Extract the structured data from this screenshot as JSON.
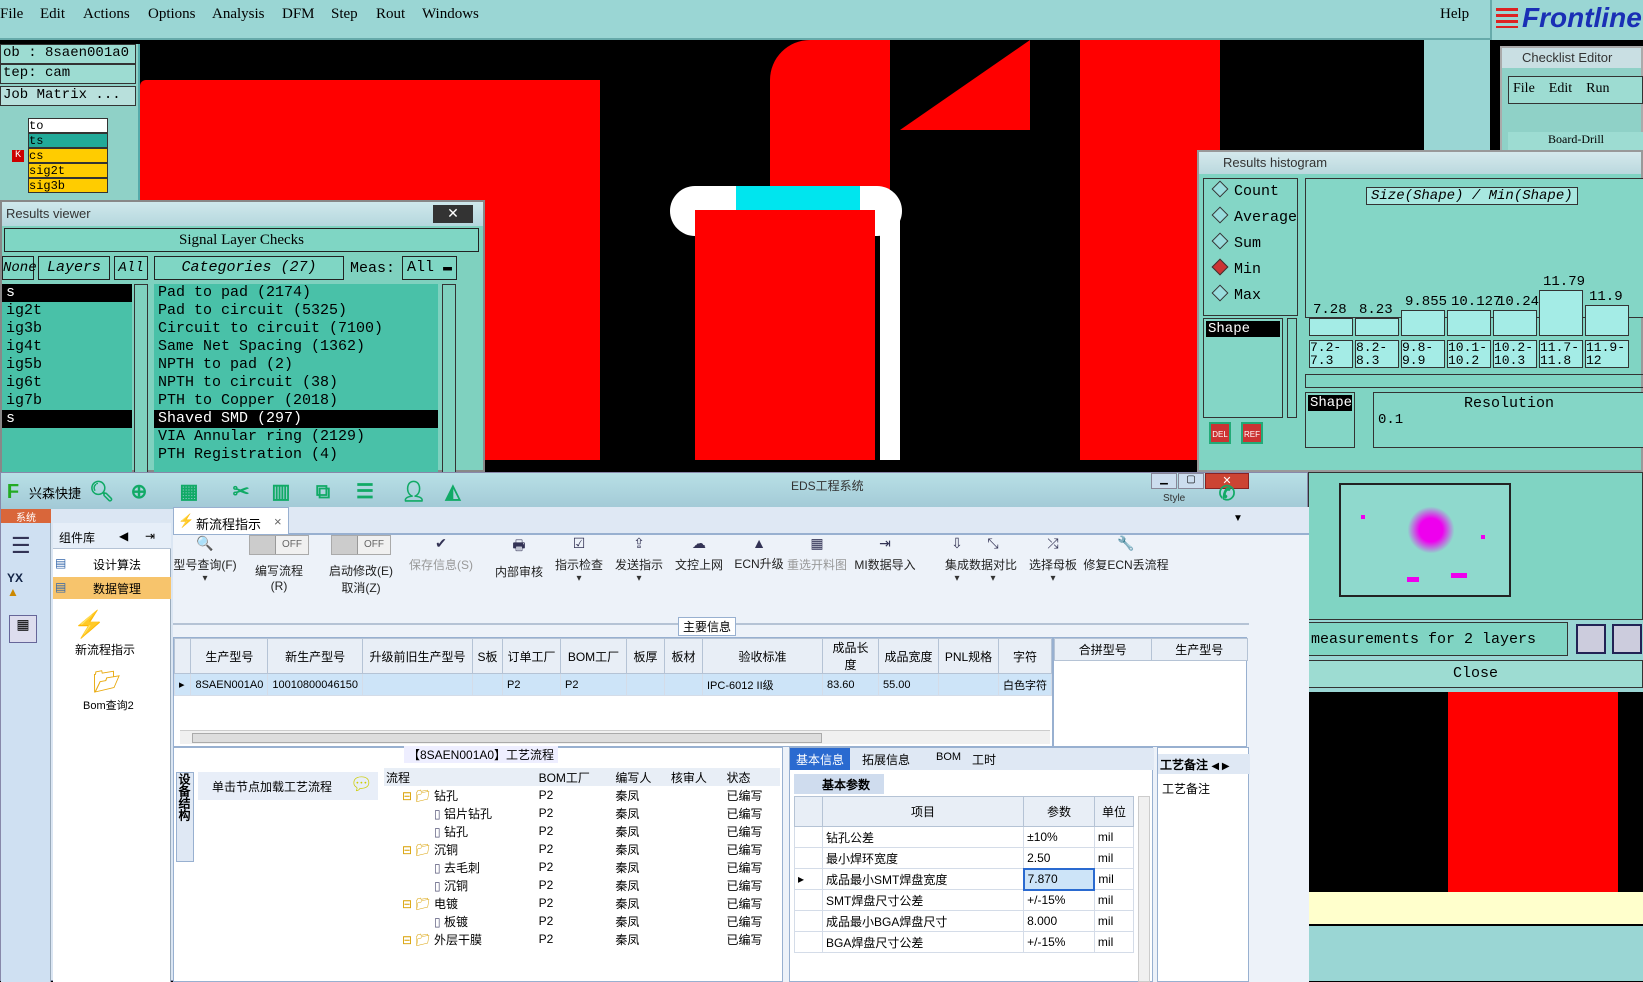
{
  "menu": {
    "items": [
      "File",
      "Edit",
      "Actions",
      "Options",
      "Analysis",
      "DFM",
      "Step",
      "Rout",
      "Windows"
    ],
    "help": "Help",
    "logo": "Frontline"
  },
  "job": {
    "job": "ob : 8saen001a0",
    "step": "tep: cam",
    "matrix": "Job Matrix ..."
  },
  "layers": [
    "to",
    "ts",
    "cs",
    "sig2t",
    "sig3b"
  ],
  "results_viewer": {
    "title": "Results viewer",
    "close": "✕",
    "header": "Signal Layer Checks",
    "none": "None",
    "layers": "Layers",
    "all": "All",
    "categories": "Categories (27)",
    "meas": "Meas:",
    "meas_value": "All",
    "layer_list": [
      "s",
      "ig2t",
      "ig3b",
      "ig4t",
      "ig5b",
      "ig6t",
      "ig7b",
      "s"
    ],
    "category_list": [
      "Pad to pad (2174)",
      "Pad to circuit (5325)",
      "Circuit to circuit (7100)",
      "Same Net Spacing (1362)",
      "NPTH to pad (2)",
      "NPTH to circuit (38)",
      "PTH to Copper (2018)",
      "Shaved SMD (297)",
      "VIA Annular ring (2129)",
      "PTH Registration (4)"
    ]
  },
  "checklist": {
    "title": "Checklist Editor",
    "menu": [
      "File",
      "Edit",
      "Run"
    ],
    "item": "Board-Drill"
  },
  "histogram": {
    "title": "Results histogram",
    "options": [
      "Count",
      "Average",
      "Sum",
      "Min",
      "Max"
    ],
    "selected": "Min",
    "list_item": "Shape",
    "del": "DEL",
    "ref": "REF",
    "heading": "Size(Shape) / Min(Shape)",
    "bins": [
      {
        "value": "7.28",
        "range": "7.2-7.3",
        "level": 0.15
      },
      {
        "value": "8.23",
        "range": "8.2-8.3",
        "level": 0.15
      },
      {
        "value": "9.855",
        "range": "9.8-9.9",
        "level": 0.22
      },
      {
        "value": "10.127",
        "range": "10.1-10.2",
        "level": 0.22
      },
      {
        "value": "10.24",
        "range": "10.2-10.3",
        "level": 0.22
      },
      {
        "value": "11.79",
        "range": "11.7-11.8",
        "level": 0.38
      },
      {
        "value": "11.9",
        "range": "11.9-12",
        "level": 0.26
      }
    ],
    "shape2": "Shape",
    "resolution": "Resolution",
    "res_value": "0.1",
    "measurements": "measurements for 2 layers",
    "close": "Close"
  },
  "eds": {
    "title": "EDS工程系统",
    "brand": "兴森快捷",
    "sys_tab": "系统",
    "style": "Style",
    "nav_title": "组件库",
    "nav_items": [
      "设计算法",
      "数据管理"
    ],
    "nav_big": [
      "新流程指示",
      "Bom查询2"
    ],
    "tab": "新流程指示",
    "ribbon": [
      {
        "label": "型号查询(F)",
        "icon": "🔍"
      },
      {
        "label": "编写流程(R)",
        "icon": "toggle"
      },
      {
        "label": "启动修改(E)\n取消(Z)",
        "icon": "toggle"
      },
      {
        "label": "保存信息(S)",
        "icon": "✔"
      },
      {
        "label": "内部审核",
        "icon": "🖶"
      },
      {
        "label": "指示检查",
        "icon": "☑"
      },
      {
        "label": "发送指示",
        "icon": "⇪"
      },
      {
        "label": "文控上网",
        "icon": "☁"
      },
      {
        "label": "ECN升级",
        "icon": "▲"
      },
      {
        "label": "重选开料图",
        "icon": "▦"
      },
      {
        "label": "MI数据导入",
        "icon": "⇥"
      },
      {
        "label": "集成",
        "icon": "⇩"
      },
      {
        "label": "数据对比",
        "icon": "⤡"
      },
      {
        "label": "选择母板",
        "icon": "⤮"
      },
      {
        "label": "修复ECN丢流程",
        "icon": "🔧"
      }
    ],
    "toggle_off": "OFF",
    "main_info": "主要信息",
    "grid_cols": [
      "生产型号",
      "新生产型号",
      "升级前旧生产型号",
      "S板",
      "订单工厂",
      "BOM工厂",
      "板厚",
      "板材",
      "验收标准",
      "成品长度",
      "成品宽度",
      "PNL规格",
      "字符"
    ],
    "grid_row": [
      "8SAEN001A0",
      "10010800046150",
      "",
      "",
      "P2",
      "P2",
      "",
      "",
      "IPC-6012 II级",
      "83.60",
      "55.00",
      "",
      "白色字符"
    ],
    "side_cols": [
      "合拼型号",
      "生产型号"
    ],
    "flow_title": "【8SAEN001A0】工艺流程",
    "vtab": "设备结构",
    "hint": "单击节点加载工艺流程",
    "tree_cols": [
      "流程",
      "BOM工厂",
      "编写人",
      "核审人",
      "状态"
    ],
    "tree_rows": [
      {
        "name": "钻孔",
        "lvl": 1,
        "bom": "P2",
        "author": "秦凤",
        "status": "已编写"
      },
      {
        "name": "铝片钻孔",
        "lvl": 2,
        "bom": "P2",
        "author": "秦凤",
        "status": "已编写"
      },
      {
        "name": "钻孔",
        "lvl": 2,
        "bom": "P2",
        "author": "秦凤",
        "status": "已编写"
      },
      {
        "name": "沉铜",
        "lvl": 1,
        "bom": "P2",
        "author": "秦凤",
        "status": "已编写"
      },
      {
        "name": "去毛刺",
        "lvl": 2,
        "bom": "P2",
        "author": "秦凤",
        "status": "已编写"
      },
      {
        "name": "沉铜",
        "lvl": 2,
        "bom": "P2",
        "author": "秦凤",
        "status": "已编写"
      },
      {
        "name": "电镀",
        "lvl": 1,
        "bom": "P2",
        "author": "秦凤",
        "status": "已编写"
      },
      {
        "name": "板镀",
        "lvl": 2,
        "bom": "P2",
        "author": "秦凤",
        "status": "已编写"
      },
      {
        "name": "外层干膜",
        "lvl": 1,
        "bom": "P2",
        "author": "秦凤",
        "status": "已编写"
      }
    ],
    "info_tabs": [
      "基本信息",
      "拓展信息",
      "BOM",
      "工时"
    ],
    "basic_params": "基本参数",
    "param_cols": [
      "项目",
      "参数",
      "单位"
    ],
    "params": [
      {
        "item": "钻孔公差",
        "value": "±10%",
        "unit": "mil"
      },
      {
        "item": "最小焊环宽度",
        "value": "2.50",
        "unit": "mil"
      },
      {
        "item": "成品最小SMT焊盘宽度",
        "value": "7.870",
        "unit": "mil"
      },
      {
        "item": "SMT焊盘尺寸公差",
        "value": "+/-15%",
        "unit": "mil"
      },
      {
        "item": "成品最小BGA焊盘尺寸",
        "value": "8.000",
        "unit": "mil"
      },
      {
        "item": "BGA焊盘尺寸公差",
        "value": "+/-15%",
        "unit": "mil"
      }
    ],
    "remark_tab": "工艺备注",
    "remark_label": "工艺备注"
  }
}
